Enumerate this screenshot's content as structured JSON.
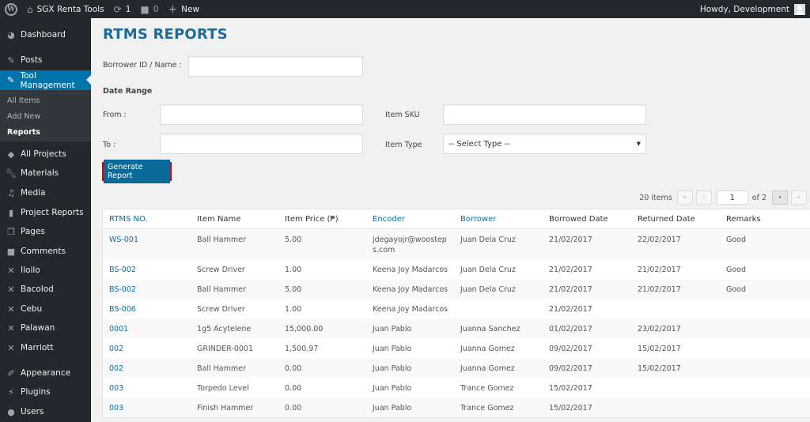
{
  "adminbar": {
    "site_name": "SGX Renta Tools",
    "updates_count": "1",
    "comments_count": "0",
    "new_label": "New",
    "howdy": "Howdy, Development"
  },
  "sidebar": {
    "items": [
      {
        "label": "Dashboard",
        "icon": "dashboard-icon"
      },
      {
        "label": "Posts",
        "icon": "pin-icon"
      },
      {
        "label": "Tool Management",
        "icon": "pin-icon",
        "active": true
      },
      {
        "label": "All Projects",
        "icon": "tag-icon"
      },
      {
        "label": "Materials",
        "icon": "wrench-icon"
      },
      {
        "label": "Media",
        "icon": "media-icon"
      },
      {
        "label": "Project Reports",
        "icon": "book-icon"
      },
      {
        "label": "Pages",
        "icon": "pages-icon"
      },
      {
        "label": "Comments",
        "icon": "comment-icon"
      },
      {
        "label": "Iloilo",
        "icon": "tools-icon"
      },
      {
        "label": "Bacolod",
        "icon": "tools-icon"
      },
      {
        "label": "Cebu",
        "icon": "tools-icon"
      },
      {
        "label": "Palawan",
        "icon": "tools-icon"
      },
      {
        "label": "Marriott",
        "icon": "tools-icon"
      },
      {
        "label": "Appearance",
        "icon": "brush-icon"
      },
      {
        "label": "Plugins",
        "icon": "plugin-icon"
      },
      {
        "label": "Users",
        "icon": "user-icon"
      }
    ],
    "submenu": [
      {
        "label": "All Items"
      },
      {
        "label": "Add New"
      },
      {
        "label": "Reports",
        "current": true
      }
    ]
  },
  "page": {
    "title": "RTMS REPORTS"
  },
  "form": {
    "borrower_label": "Borrower ID / Name :",
    "borrower_value": "",
    "date_range_label": "Date Range",
    "from_label": "From :",
    "from_value": "",
    "to_label": "To :",
    "to_value": "",
    "sku_label": "Item SKU",
    "sku_value": "",
    "type_label": "Item Type",
    "type_selected": "-- Select Type --",
    "generate_label": "Generate Report"
  },
  "pagination": {
    "items_count": "20 items",
    "first": "«",
    "prev": "‹",
    "current_page": "1",
    "of_label": "of 2",
    "next": "›",
    "last": "»"
  },
  "table": {
    "columns": [
      "RTMS NO.",
      "Item Name",
      "Item Price (₱)",
      "Encoder",
      "Borrower",
      "Borrowed Date",
      "Returned Date",
      "Remarks"
    ],
    "rows": [
      [
        "WS-001",
        "Ball Hammer",
        "5.00",
        "jdegayojr@woosteps.com",
        "Juan Dela Cruz",
        "21/02/2017",
        "22/02/2017",
        "Good"
      ],
      [
        "BS-002",
        "Screw Driver",
        "1.00",
        "Keena Joy Madarcos",
        "Juan Dela Cruz",
        "21/02/2017",
        "21/02/2017",
        "Good"
      ],
      [
        "BS-002",
        "Ball Hammer",
        "5.00",
        "Keena Joy Madarcos",
        "Juan Dela Cruz",
        "21/02/2017",
        "21/02/2017",
        "Good"
      ],
      [
        "BS-006",
        "Screw Driver",
        "1.00",
        "Keena Joy Madarcos",
        "",
        "21/02/2017",
        "",
        ""
      ],
      [
        "0001",
        "1g5 Acytelene",
        "15,000.00",
        "Juan Pablo",
        "Juanna Sanchez",
        "01/02/2017",
        "23/02/2017",
        ""
      ],
      [
        "002",
        "GRINDER-0001",
        "1,500.97",
        "Juan Pablo",
        "Juanna Gomez",
        "09/02/2017",
        "15/02/2017",
        ""
      ],
      [
        "002",
        "Ball Hammer",
        "0.00",
        "Juan Pablo",
        "Juanna Gomez",
        "09/02/2017",
        "15/02/2017",
        ""
      ],
      [
        "003",
        "Torpedo Level",
        "0.00",
        "Juan Pablo",
        "Trance Gomez",
        "15/02/2017",
        "",
        ""
      ],
      [
        "003",
        "Finish Hammer",
        "0.00",
        "Juan Pablo",
        "Trance Gomez",
        "15/02/2017",
        "",
        ""
      ]
    ]
  }
}
